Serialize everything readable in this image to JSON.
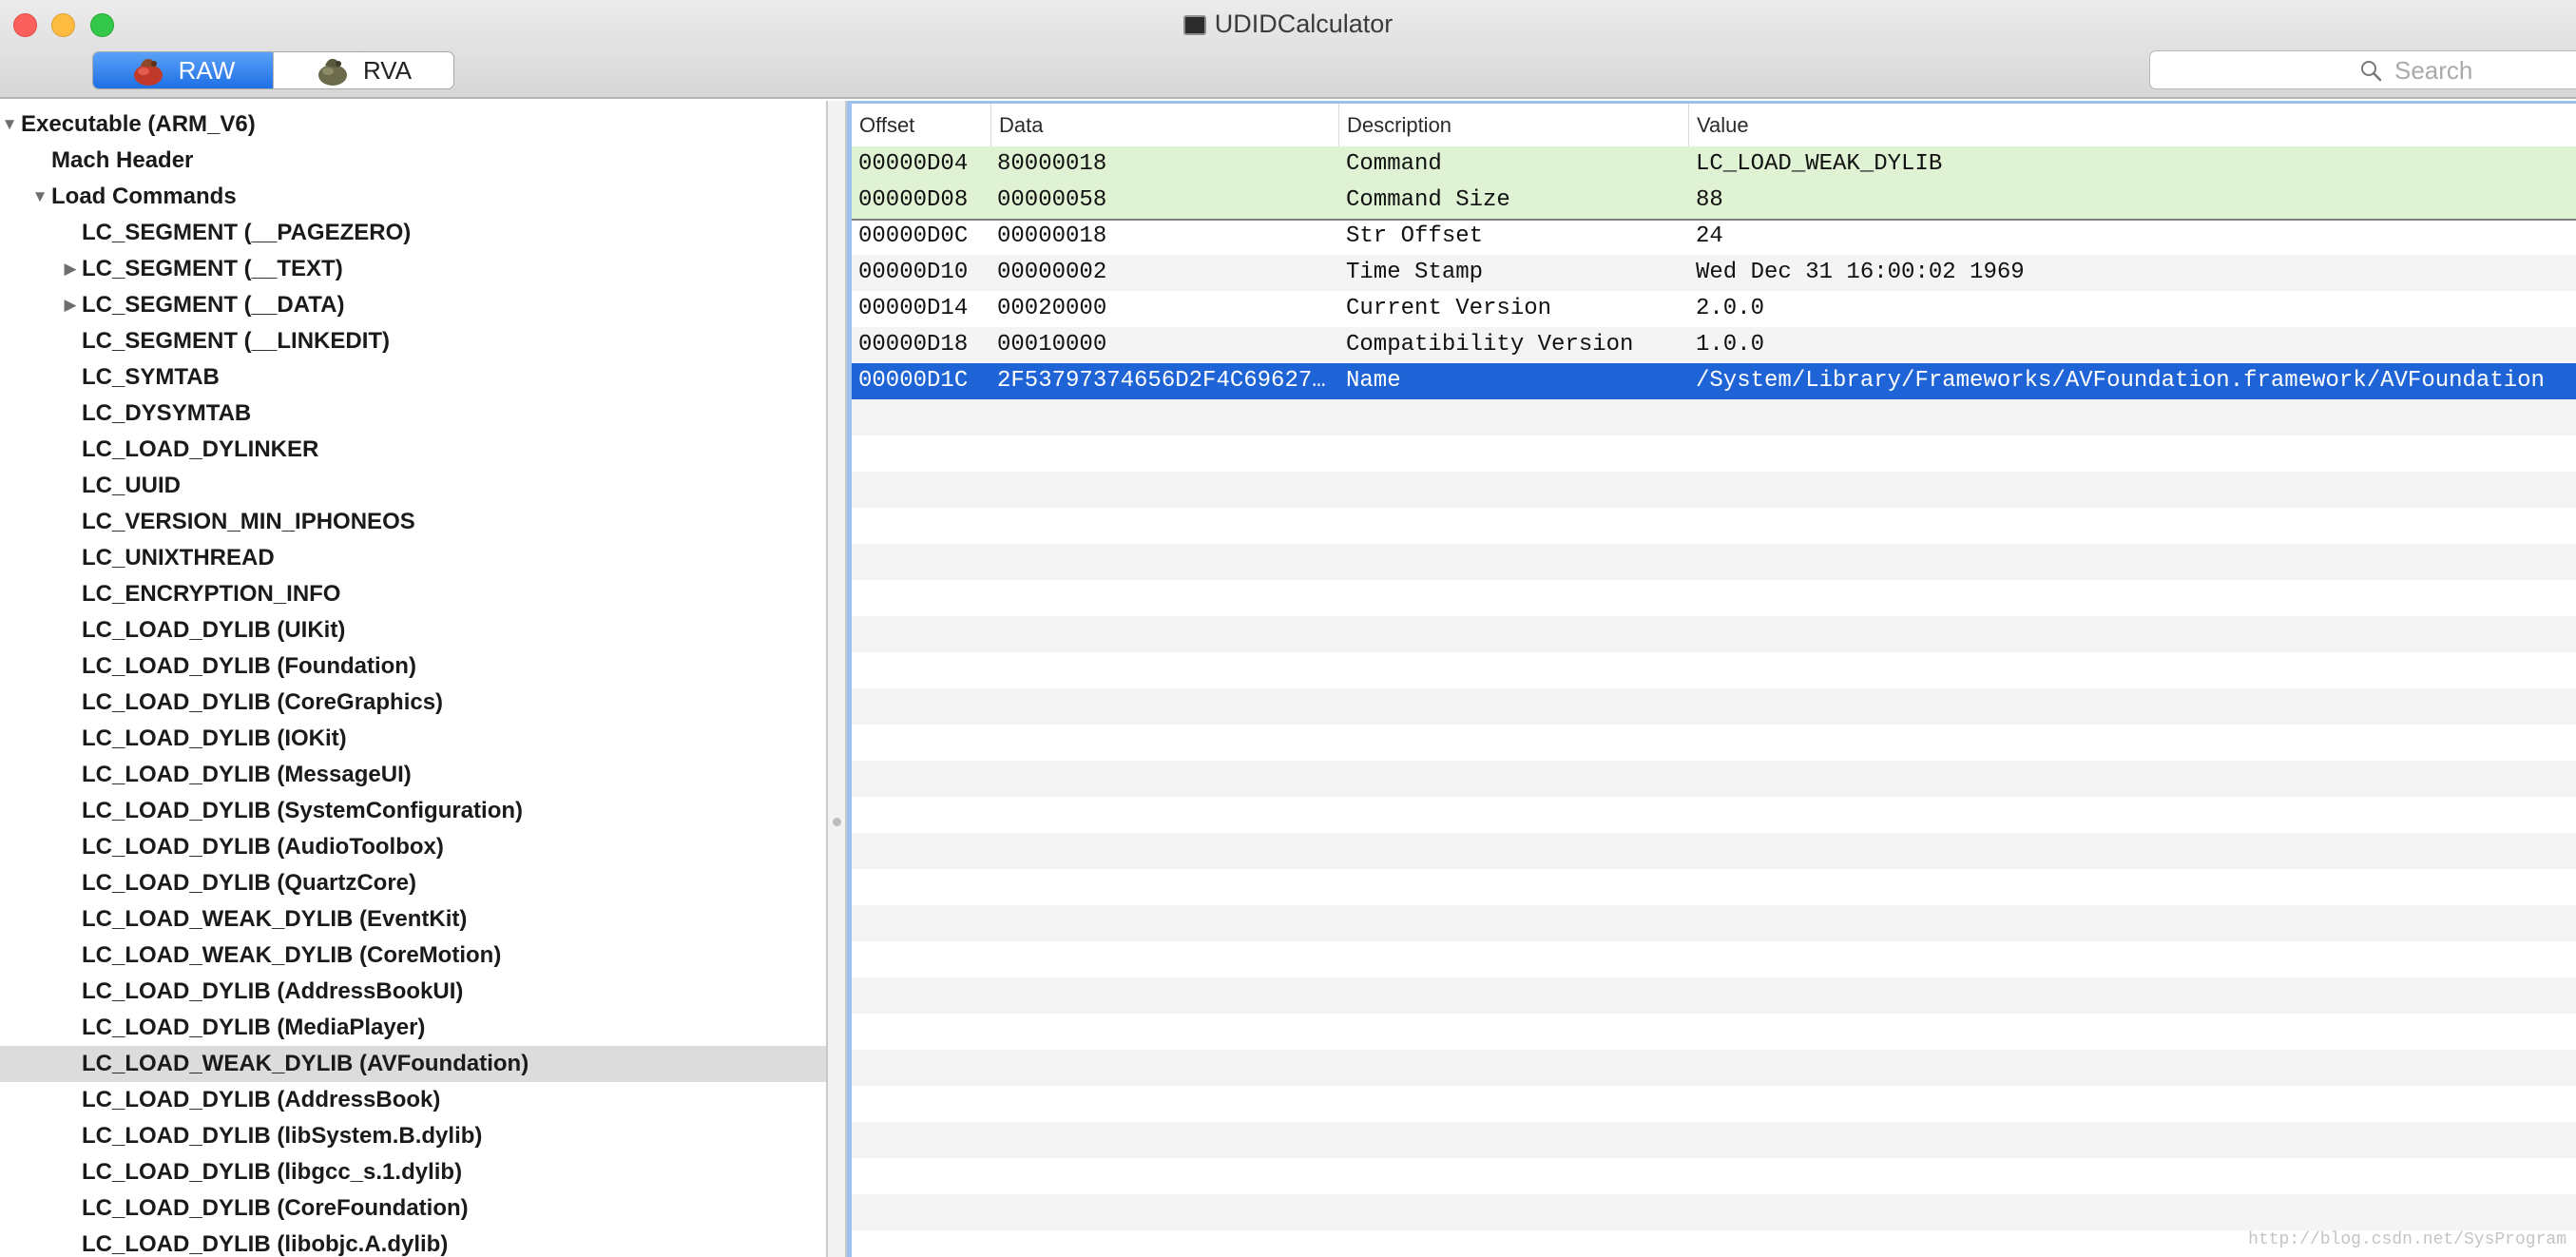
{
  "window": {
    "title": "UDIDCalculator",
    "icon": "terminal-app-icon"
  },
  "toolbar": {
    "segments": [
      {
        "label": "RAW",
        "icon": "raw-mode-icon",
        "selected": true
      },
      {
        "label": "RVA",
        "icon": "rva-mode-icon",
        "selected": false
      }
    ],
    "search": {
      "placeholder": "Search",
      "value": ""
    }
  },
  "outline": {
    "items": [
      {
        "label": "Executable  (ARM_V6)",
        "level": 0,
        "disclosure": "open"
      },
      {
        "label": "Mach Header",
        "level": 1,
        "disclosure": "none"
      },
      {
        "label": "Load Commands",
        "level": 1,
        "disclosure": "open"
      },
      {
        "label": "LC_SEGMENT (__PAGEZERO)",
        "level": 2,
        "disclosure": "none"
      },
      {
        "label": "LC_SEGMENT (__TEXT)",
        "level": 2,
        "disclosure": "closed"
      },
      {
        "label": "LC_SEGMENT (__DATA)",
        "level": 2,
        "disclosure": "closed"
      },
      {
        "label": "LC_SEGMENT (__LINKEDIT)",
        "level": 2,
        "disclosure": "none"
      },
      {
        "label": "LC_SYMTAB",
        "level": 2,
        "disclosure": "none"
      },
      {
        "label": "LC_DYSYMTAB",
        "level": 2,
        "disclosure": "none"
      },
      {
        "label": "LC_LOAD_DYLINKER",
        "level": 2,
        "disclosure": "none"
      },
      {
        "label": "LC_UUID",
        "level": 2,
        "disclosure": "none"
      },
      {
        "label": "LC_VERSION_MIN_IPHONEOS",
        "level": 2,
        "disclosure": "none"
      },
      {
        "label": "LC_UNIXTHREAD",
        "level": 2,
        "disclosure": "none"
      },
      {
        "label": "LC_ENCRYPTION_INFO",
        "level": 2,
        "disclosure": "none"
      },
      {
        "label": "LC_LOAD_DYLIB (UIKit)",
        "level": 2,
        "disclosure": "none"
      },
      {
        "label": "LC_LOAD_DYLIB (Foundation)",
        "level": 2,
        "disclosure": "none"
      },
      {
        "label": "LC_LOAD_DYLIB (CoreGraphics)",
        "level": 2,
        "disclosure": "none"
      },
      {
        "label": "LC_LOAD_DYLIB (IOKit)",
        "level": 2,
        "disclosure": "none"
      },
      {
        "label": "LC_LOAD_DYLIB (MessageUI)",
        "level": 2,
        "disclosure": "none"
      },
      {
        "label": "LC_LOAD_DYLIB (SystemConfiguration)",
        "level": 2,
        "disclosure": "none"
      },
      {
        "label": "LC_LOAD_DYLIB (AudioToolbox)",
        "level": 2,
        "disclosure": "none"
      },
      {
        "label": "LC_LOAD_DYLIB (QuartzCore)",
        "level": 2,
        "disclosure": "none"
      },
      {
        "label": "LC_LOAD_WEAK_DYLIB (EventKit)",
        "level": 2,
        "disclosure": "none"
      },
      {
        "label": "LC_LOAD_WEAK_DYLIB (CoreMotion)",
        "level": 2,
        "disclosure": "none"
      },
      {
        "label": "LC_LOAD_DYLIB (AddressBookUI)",
        "level": 2,
        "disclosure": "none"
      },
      {
        "label": "LC_LOAD_DYLIB (MediaPlayer)",
        "level": 2,
        "disclosure": "none"
      },
      {
        "label": "LC_LOAD_WEAK_DYLIB (AVFoundation)",
        "level": 2,
        "disclosure": "none",
        "selected": true
      },
      {
        "label": "LC_LOAD_DYLIB (AddressBook)",
        "level": 2,
        "disclosure": "none"
      },
      {
        "label": "LC_LOAD_DYLIB (libSystem.B.dylib)",
        "level": 2,
        "disclosure": "none"
      },
      {
        "label": "LC_LOAD_DYLIB (libgcc_s.1.dylib)",
        "level": 2,
        "disclosure": "none"
      },
      {
        "label": "LC_LOAD_DYLIB (CoreFoundation)",
        "level": 2,
        "disclosure": "none"
      },
      {
        "label": "LC_LOAD_DYLIB (libobjc.A.dylib)",
        "level": 2,
        "disclosure": "none"
      }
    ]
  },
  "table": {
    "columns": [
      "Offset",
      "Data",
      "Description",
      "Value"
    ],
    "rows": [
      {
        "offset": "00000D04",
        "data": "80000018",
        "description": "Command",
        "value": "LC_LOAD_WEAK_DYLIB",
        "state": "highlight"
      },
      {
        "offset": "00000D08",
        "data": "00000058",
        "description": "Command Size",
        "value": "88",
        "state": "highlight-end"
      },
      {
        "offset": "00000D0C",
        "data": "00000018",
        "description": "Str Offset",
        "value": "24",
        "state": "normal"
      },
      {
        "offset": "00000D10",
        "data": "00000002",
        "description": "Time Stamp",
        "value": "Wed Dec 31 16:00:02 1969",
        "state": "normal"
      },
      {
        "offset": "00000D14",
        "data": "00020000",
        "description": "Current Version",
        "value": "2.0.0",
        "state": "normal"
      },
      {
        "offset": "00000D18",
        "data": "00010000",
        "description": "Compatibility Version",
        "value": "1.0.0",
        "state": "normal"
      },
      {
        "offset": "00000D1C",
        "data": "2F53797374656D2F4C69627…",
        "description": "Name",
        "value": "/System/Library/Frameworks/AVFoundation.framework/AVFoundation",
        "state": "selected"
      }
    ]
  },
  "watermark": "http://blog.csdn.net/SysProgram",
  "colors": {
    "selection_blue": "#1f64d6",
    "highlight_green": "#dff3d4",
    "outline_selection": "#dcdcdc",
    "segment_blue": "#2f7cf0"
  }
}
